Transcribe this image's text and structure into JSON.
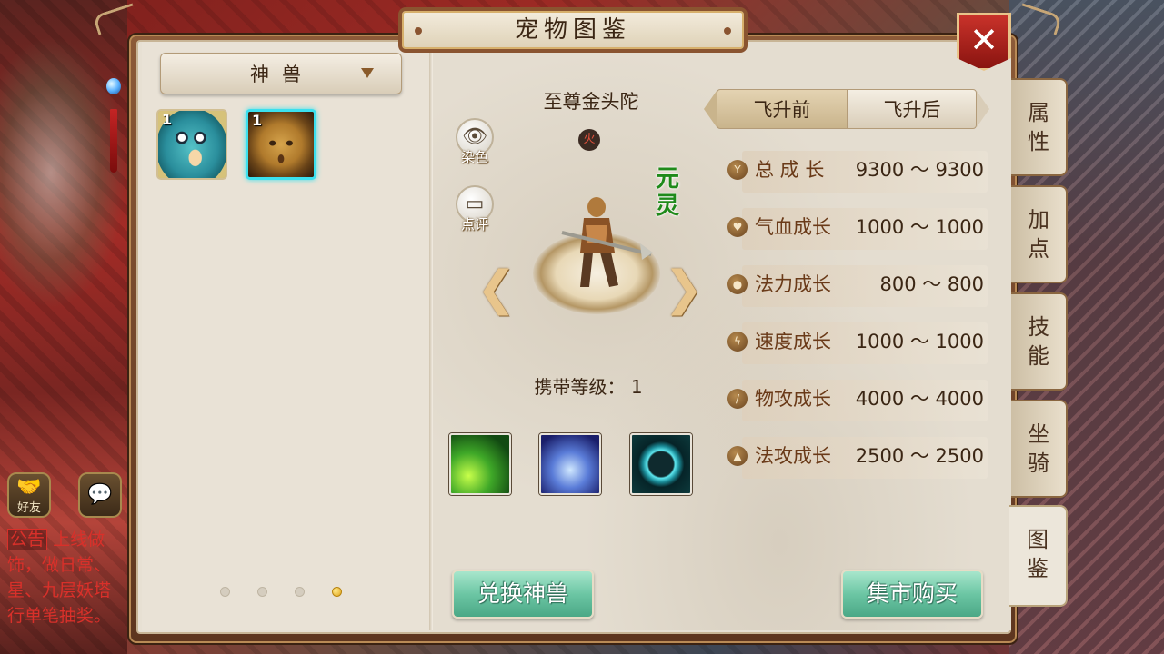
{
  "window": {
    "title": "宠物图鉴",
    "close_icon": "close-icon"
  },
  "left_panel": {
    "category": "神兽",
    "pets": [
      {
        "level": "1",
        "name": "fish-beast"
      },
      {
        "level": "1",
        "name": "golden-monk"
      }
    ],
    "pages": {
      "count": 4,
      "active_index": 3
    }
  },
  "pet_detail": {
    "name": "至尊金头陀",
    "element": "火",
    "realm": "元灵",
    "dye_label": "染色",
    "review_label": "点评",
    "carry_level_label": "携带等级：",
    "carry_level_value": "1",
    "skills": [
      "dragon-claw-skill",
      "palm-strike-skill",
      "ring-skill"
    ]
  },
  "flight_tabs": {
    "before": "飞升前",
    "after": "飞升后",
    "selected": "飞升前"
  },
  "stats": [
    {
      "name": "总 成 长",
      "icon": "growth-icon",
      "range": "9300 ～ 9300"
    },
    {
      "name": "气血成长",
      "icon": "heart-icon",
      "range": "1000 ～ 1000"
    },
    {
      "name": "法力成长",
      "icon": "drop-icon",
      "range": "800 ～ 800"
    },
    {
      "name": "速度成长",
      "icon": "bolt-icon",
      "range": "1000 ～ 1000"
    },
    {
      "name": "物攻成长",
      "icon": "sword-icon",
      "range": "4000 ～ 4000"
    },
    {
      "name": "法攻成长",
      "icon": "flame-icon",
      "range": "2500 ～ 2500"
    }
  ],
  "buttons": {
    "exchange": "兑换神兽",
    "market": "集市购买"
  },
  "side_tabs": [
    {
      "label": "属性"
    },
    {
      "label": "加点"
    },
    {
      "label": "技能"
    },
    {
      "label": "坐骑"
    },
    {
      "label": "图鉴",
      "active": true
    }
  ],
  "hud": {
    "friends_label": "好友",
    "announcement_tag": "公告",
    "announcement_lines": [
      "上线做",
      "饰，做日常、",
      "星、九层妖塔",
      "行单笔抽奖。"
    ]
  },
  "colors": {
    "realm_green": "#1f8a1a",
    "button_green": "#6cc6a4",
    "selected_cyan": "#3be0ee",
    "announce_red": "#d9302a"
  }
}
